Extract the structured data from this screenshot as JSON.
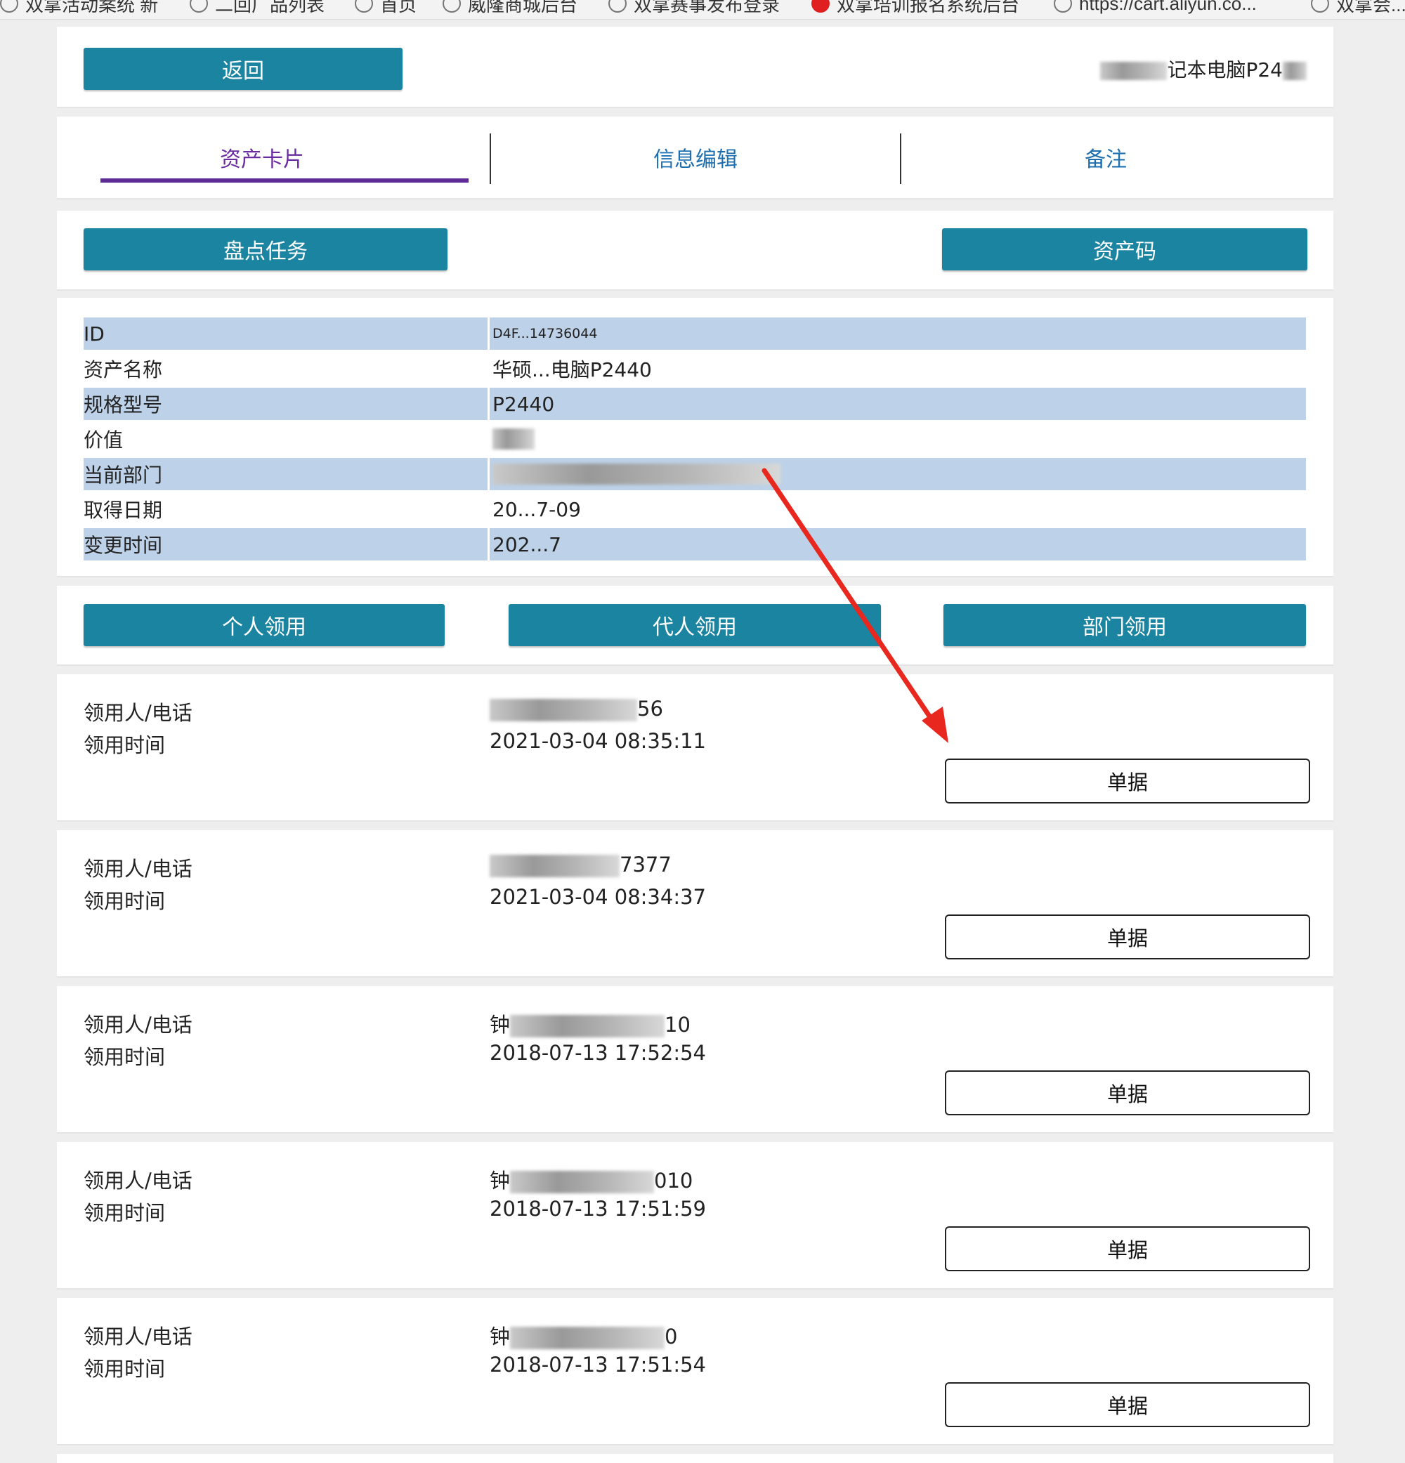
{
  "bookmarks": [
    {
      "label": "双拿活动案统 新",
      "icon": "globe-icon",
      "color": ""
    },
    {
      "label": "二回广品列表",
      "icon": "globe-icon",
      "color": ""
    },
    {
      "label": "首页",
      "icon": "globe-icon",
      "color": ""
    },
    {
      "label": "威隆商城后台",
      "icon": "globe-icon",
      "color": ""
    },
    {
      "label": "双拿赛事发布登录",
      "icon": "globe-icon",
      "color": ""
    },
    {
      "label": "双拿培训报名系统后台",
      "icon": "record-icon",
      "color": "#e02020"
    },
    {
      "label": "https://cart.aliyun.co...",
      "icon": "globe-icon",
      "color": ""
    },
    {
      "label": "双拿会...",
      "icon": "globe-icon",
      "color": ""
    }
  ],
  "header": {
    "back_label": "返回",
    "asset_title_suffix": "记本电脑P24"
  },
  "tabs": [
    {
      "label": "资产卡片",
      "active": true
    },
    {
      "label": "信息编辑",
      "active": false
    },
    {
      "label": "备注",
      "active": false
    }
  ],
  "actions": {
    "inventory_task_label": "盘点任务",
    "asset_code_label": "资产码"
  },
  "info": [
    {
      "label": "ID",
      "value": "D4F...14736044"
    },
    {
      "label": "资产名称",
      "value": "华硕...电脑P2440"
    },
    {
      "label": "规格型号",
      "value": "P2440"
    },
    {
      "label": "价值",
      "value": ""
    },
    {
      "label": "当前部门",
      "value": ""
    },
    {
      "label": "取得日期",
      "value": "20...7-09"
    },
    {
      "label": "变更时间",
      "value": "202...7"
    }
  ],
  "claim_buttons": {
    "personal_label": "个人领用",
    "proxy_label": "代人领用",
    "department_label": "部门领用"
  },
  "records_labels": {
    "claimant_label": "领用人/电话",
    "time_label": "领用时间",
    "doc_button_label": "单据"
  },
  "records": [
    {
      "claimant_prefix": "",
      "claimant_suffix": "56",
      "time": "2021-03-04 08:35:11"
    },
    {
      "claimant_prefix": "",
      "claimant_suffix": "7377",
      "time": "2021-03-04 08:34:37"
    },
    {
      "claimant_prefix": "钟",
      "claimant_suffix": "10",
      "time": "2018-07-13 17:52:54"
    },
    {
      "claimant_prefix": "钟",
      "claimant_suffix": "010",
      "time": "2018-07-13 17:51:59"
    },
    {
      "claimant_prefix": "钟",
      "claimant_suffix": "0",
      "time": "2018-07-13 17:51:54"
    }
  ],
  "annotation": {
    "arrow_color": "#e8281e"
  }
}
